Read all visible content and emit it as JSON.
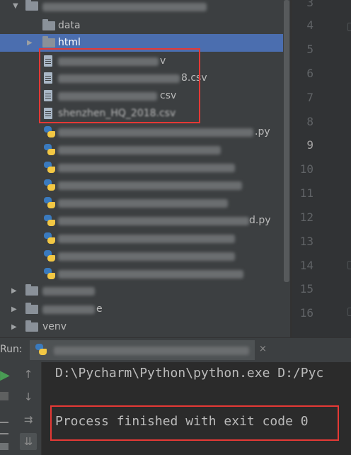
{
  "project_tree": {
    "data_folder": "data",
    "html_folder": "html",
    "csv_files": [
      "v",
      "8.csv",
      "csv",
      "shenzhen_HQ_2018.csv"
    ],
    "py_suffix_a": ".py",
    "py_suffix_b": "d.py",
    "folder_tail_b": "e",
    "venv_folder": "venv"
  },
  "gutter": {
    "line_numbers": [
      "3",
      "4",
      "5",
      "6",
      "7",
      "8",
      "9",
      "10",
      "11",
      "12",
      "13",
      "14",
      "15",
      "16"
    ],
    "current_line": "9"
  },
  "run_panel": {
    "label": "Run:",
    "close_symbol": "×"
  },
  "console": {
    "command": "D:\\Pycharm\\Python\\python.exe D:/Pyc",
    "exit_message": "Process finished with exit code 0"
  }
}
